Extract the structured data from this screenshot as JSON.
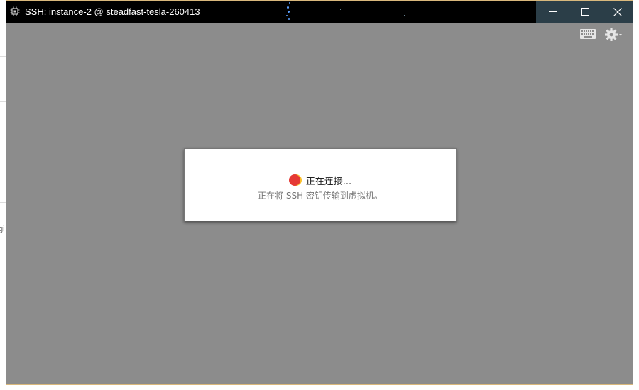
{
  "window": {
    "title": "SSH: instance-2 @ steadfast-tesla-260413",
    "app_icon": "chip-icon",
    "controls": [
      "minimize-icon",
      "maximize-icon",
      "close-icon"
    ],
    "titlebar_color": "#000000",
    "controls_bg": "#2b3e48"
  },
  "terminal": {
    "background": "#8c8c8c",
    "toolbar_icons": [
      "keyboard-icon",
      "gear-icon"
    ]
  },
  "dialog": {
    "status": "正在连接...",
    "detail": "正在将 SSH 密钥传输到虚拟机。",
    "spinner_colors": [
      "#e53935",
      "#fbc02d"
    ]
  },
  "background_window": {
    "edge_text": "gi"
  }
}
